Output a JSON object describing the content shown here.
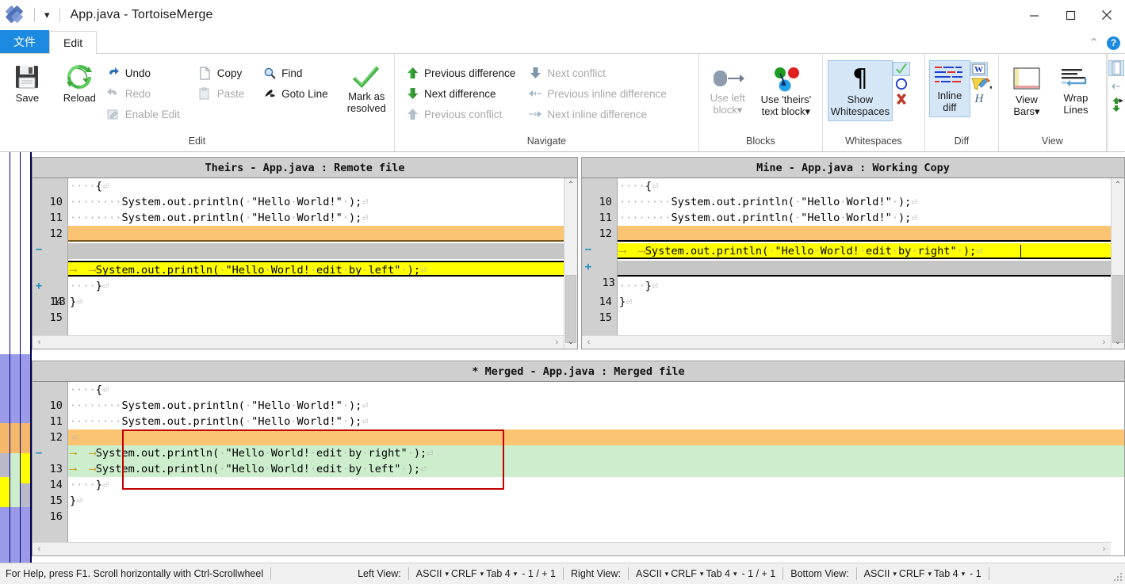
{
  "window": {
    "title": "App.java - TortoiseMerge",
    "quick_access_caret": "▾",
    "minimize": "minimize-button",
    "maximize": "maximize-button",
    "close": "close-button"
  },
  "tabs": [
    {
      "label": "文件",
      "state": "active-blue"
    },
    {
      "label": "Edit",
      "state": "active-white"
    }
  ],
  "ribbon": {
    "collapse_caret": "⌃",
    "help_label": "?",
    "groups": [
      {
        "title": "Edit",
        "big": [
          {
            "label": "Save",
            "icon": "save-icon",
            "enabled": true
          },
          {
            "label": "Reload",
            "icon": "reload-icon",
            "enabled": true
          }
        ],
        "small_col1": [
          {
            "label": "Undo",
            "icon": "undo-icon",
            "enabled": true
          },
          {
            "label": "Redo",
            "icon": "redo-icon",
            "enabled": false
          },
          {
            "label": "Enable Edit",
            "icon": "enable-edit-icon",
            "enabled": false
          }
        ],
        "small_col2": [
          {
            "label": "Copy",
            "icon": "copy-icon",
            "enabled": true
          },
          {
            "label": "Paste",
            "icon": "paste-icon",
            "enabled": false
          }
        ],
        "small_col3": [
          {
            "label": "Find",
            "icon": "find-icon",
            "enabled": true
          },
          {
            "label": "Goto Line",
            "icon": "goto-line-icon",
            "enabled": true
          }
        ],
        "big2": [
          {
            "label": "Mark as resolved",
            "icon": "checkmark-icon",
            "enabled": true
          }
        ]
      },
      {
        "title": "Navigate",
        "col1": [
          {
            "label": "Previous difference",
            "icon": "arrow-up-green-icon",
            "enabled": true
          },
          {
            "label": "Next difference",
            "icon": "arrow-down-green-icon",
            "enabled": true
          },
          {
            "label": "Previous conflict",
            "icon": "arrow-up-gray-icon",
            "enabled": false
          }
        ],
        "col2": [
          {
            "label": "Next conflict",
            "icon": "arrow-down-gray-icon",
            "enabled": false
          },
          {
            "label": "Previous inline difference",
            "icon": "inline-prev-icon",
            "enabled": false
          },
          {
            "label": "Next inline difference",
            "icon": "inline-next-icon",
            "enabled": false
          }
        ]
      },
      {
        "title": "Blocks",
        "items": [
          {
            "label": "Use left block",
            "icon": "use-left-block-icon",
            "enabled": false,
            "caret": "▾"
          },
          {
            "label": "Use 'theirs' text block",
            "icon": "use-theirs-block-icon",
            "enabled": true,
            "caret": "▾"
          }
        ]
      },
      {
        "title": "Whitespaces",
        "items": [
          {
            "label": "Show Whitespaces",
            "icon": "pilcrow-icon",
            "enabled": true,
            "selected": true
          }
        ],
        "side_icons": [
          {
            "icon": "green-check-icon",
            "selected": true
          },
          {
            "icon": "blue-circle-icon",
            "selected": false
          },
          {
            "icon": "red-x-icon",
            "selected": false
          }
        ]
      },
      {
        "title": "Diff",
        "items": [
          {
            "label": "Inline diff",
            "icon": "inline-diff-icon",
            "enabled": true,
            "selected": true
          }
        ],
        "side_icons": [
          {
            "icon": "word-diff-icon",
            "selected": true
          },
          {
            "icon": "highlighter-icon",
            "selected": false,
            "caret": "▾"
          },
          {
            "icon": "script-h-icon",
            "selected": false
          }
        ]
      },
      {
        "title": "View",
        "items": [
          {
            "label": "View Bars",
            "icon": "view-bars-icon",
            "enabled": true,
            "caret": "▾"
          },
          {
            "label": "Wrap Lines",
            "icon": "wrap-lines-icon",
            "enabled": true
          }
        ],
        "overflow": "▸"
      }
    ]
  },
  "panes": {
    "left": {
      "title": "Theirs - App.java : Remote file",
      "lines": [
        {
          "num": "10",
          "mark": "",
          "indent_dots": 4,
          "text": "{",
          "eol": "⏎",
          "bg": "none"
        },
        {
          "num": "11",
          "mark": "",
          "indent_dots": 8,
          "text": "System.out.println(·\"Hello·World!\"·);",
          "eol": "⏎",
          "bg": "none"
        },
        {
          "num": "12",
          "mark": "",
          "indent_dots": 8,
          "text": "System.out.println(·\"Hello·World!\"·);",
          "eol": "⏎",
          "bg": "none"
        },
        {
          "num": "",
          "mark": "−",
          "indent_dots": 0,
          "text": "",
          "eol": "",
          "bg": "orange"
        },
        {
          "num": "",
          "mark": "",
          "indent_dots": 0,
          "text": "",
          "eol": "",
          "bg": "gray"
        },
        {
          "num": "13",
          "mark": "+",
          "indent_dots": 0,
          "tabs": 2,
          "text": "System.out.println(·\"Hello·World!·edit·by·left\"·);",
          "eol": "⏎",
          "bg": "yellow"
        },
        {
          "num": "14",
          "mark": "",
          "indent_dots": 4,
          "text": "}",
          "eol": "⏎",
          "bg": "none"
        },
        {
          "num": "15",
          "mark": "",
          "indent_dots": 0,
          "text": "}",
          "eol": "⏎",
          "bg": "none"
        }
      ]
    },
    "right": {
      "title": "Mine - App.java : Working Copy",
      "lines": [
        {
          "num": "10",
          "mark": "",
          "indent_dots": 4,
          "text": "{",
          "eol": "⏎",
          "bg": "none"
        },
        {
          "num": "11",
          "mark": "",
          "indent_dots": 8,
          "text": "System.out.println(·\"Hello·World!\"·);",
          "eol": "⏎",
          "bg": "none"
        },
        {
          "num": "12",
          "mark": "",
          "indent_dots": 8,
          "text": "System.out.println(·\"Hello·World!\"·);",
          "eol": "⏎",
          "bg": "none"
        },
        {
          "num": "",
          "mark": "−",
          "indent_dots": 0,
          "text": "",
          "eol": "",
          "bg": "orange"
        },
        {
          "num": "13",
          "mark": "+",
          "indent_dots": 0,
          "tabs": 2,
          "text": "System.out.println(·\"Hello·World!·edit·by·right\"·);",
          "eol": "⏎",
          "bg": "yellow"
        },
        {
          "num": "",
          "mark": "",
          "indent_dots": 0,
          "text": "",
          "eol": "",
          "bg": "gray"
        },
        {
          "num": "14",
          "mark": "",
          "indent_dots": 4,
          "text": "}",
          "eol": "⏎",
          "bg": "none"
        },
        {
          "num": "15",
          "mark": "",
          "indent_dots": 0,
          "text": "}",
          "eol": "⏎",
          "bg": "none"
        }
      ]
    },
    "merged": {
      "title": "* Merged - App.java : Merged file",
      "lines": [
        {
          "num": "10",
          "mark": "",
          "indent_dots": 4,
          "text": "{",
          "eol": "⏎",
          "bg": "none"
        },
        {
          "num": "11",
          "mark": "",
          "indent_dots": 8,
          "text": "System.out.println(·\"Hello·World!\"·);",
          "eol": "⏎",
          "bg": "none"
        },
        {
          "num": "12",
          "mark": "",
          "indent_dots": 8,
          "text": "System.out.println(·\"Hello·World!\"·);",
          "eol": "⏎",
          "bg": "none"
        },
        {
          "num": "",
          "mark": "−",
          "indent_dots": 0,
          "text": "",
          "eol": "⏎",
          "bg": "orange"
        },
        {
          "num": "13",
          "mark": "",
          "indent_dots": 0,
          "tabs": 2,
          "text": "System.out.println(·\"Hello·World!·edit·by·right\"·);",
          "eol": "⏎",
          "bg": "green"
        },
        {
          "num": "14",
          "mark": "",
          "indent_dots": 0,
          "tabs": 2,
          "text": "System.out.println(·\"Hello·World!·edit·by·left\"·);",
          "eol": "⏎",
          "bg": "green"
        },
        {
          "num": "15",
          "mark": "",
          "indent_dots": 4,
          "text": "}",
          "eol": "⏎",
          "bg": "none"
        },
        {
          "num": "16",
          "mark": "",
          "indent_dots": 0,
          "text": "}",
          "eol": "⏎",
          "bg": "none"
        }
      ]
    }
  },
  "status_bar": {
    "help_text": "For Help, press F1. Scroll horizontally with Ctrl-Scrollwheel",
    "views": [
      {
        "name": "Left View:",
        "encoding": "ASCII",
        "eol": "CRLF",
        "tab": "Tab 4",
        "counts": "- 1 / + 1"
      },
      {
        "name": "Right View:",
        "encoding": "ASCII",
        "eol": "CRLF",
        "tab": "Tab 4",
        "counts": "- 1 / + 1"
      },
      {
        "name": "Bottom View:",
        "encoding": "ASCII",
        "eol": "CRLF",
        "tab": "Tab 4",
        "counts": "- 1"
      }
    ],
    "caret_glyph": "▾"
  },
  "colors": {
    "accent_blue": "#1b8ae0",
    "diff_orange": "#fbc472",
    "diff_yellow": "#ffff00",
    "diff_green": "#cdeecd",
    "diff_gray": "#c6c6c6",
    "annotation_red": "#c20000",
    "locator_purple": "#9a9ae8"
  }
}
